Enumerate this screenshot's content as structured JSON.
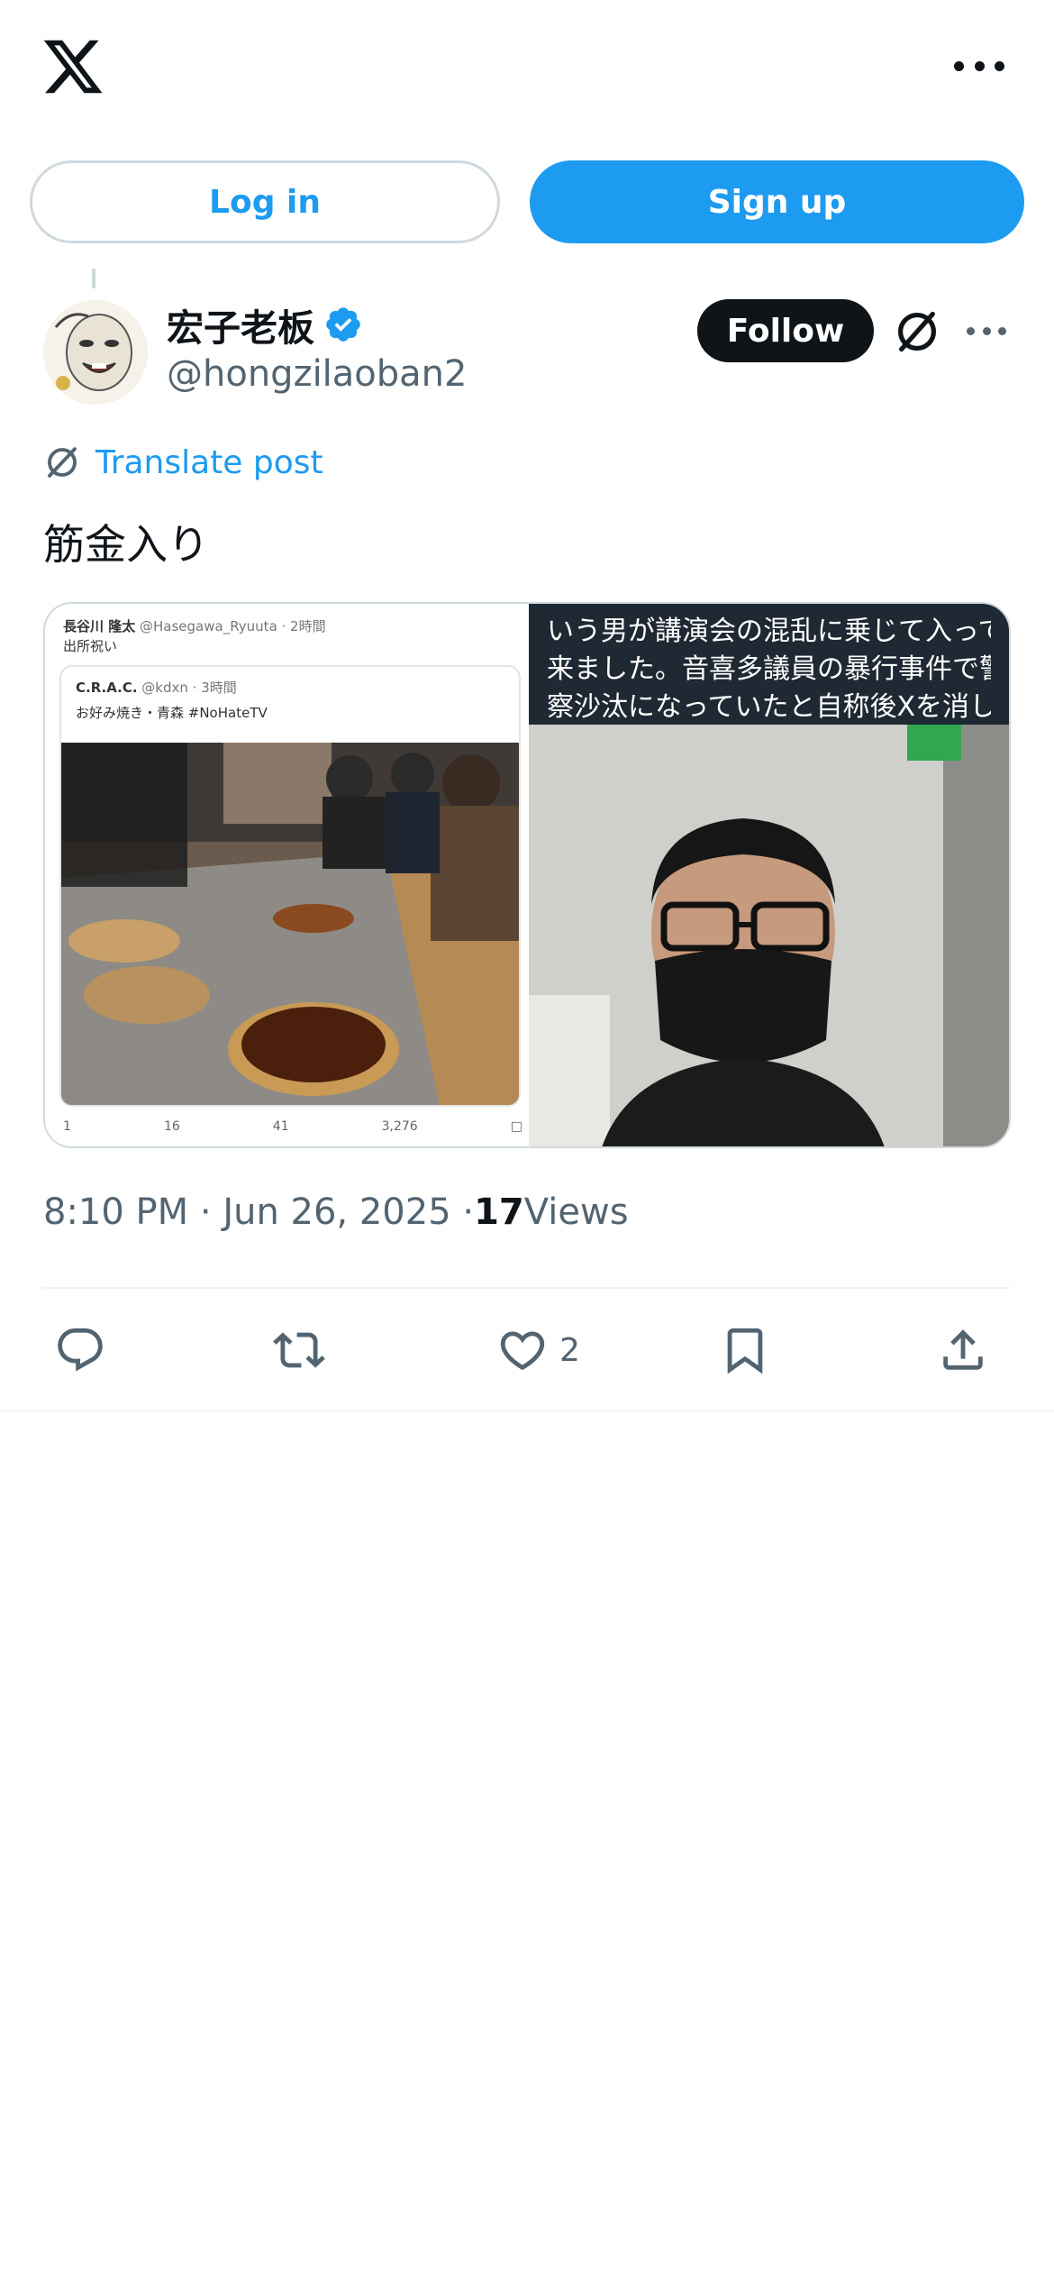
{
  "header": {
    "logo_icon": "x-logo-icon",
    "more_icon": "more-horizontal-icon"
  },
  "auth": {
    "login_label": "Log in",
    "signup_label": "Sign up"
  },
  "post": {
    "author": {
      "display_name": "宏子老板",
      "handle": "@hongzilaoban2",
      "verified": true
    },
    "follow_label": "Follow",
    "translate_label": "Translate post",
    "text": "筋金入り",
    "timestamp": "8:10 PM · Jun 26, 2025 · ",
    "views_count": "17",
    "views_label": " Views",
    "actions": {
      "reply_count": "",
      "repost_count": "",
      "like_count": "2"
    }
  },
  "media": {
    "left_image": {
      "author_name": "長谷川 隆太",
      "author_meta": " @Hasegawa_Ryuuta · 2時間",
      "text": "出所祝い",
      "quoted": {
        "author_name": "C.R.A.C.",
        "author_meta": " @kdxn · 3時間",
        "text": "お好み焼き・青森 #NoHateTV"
      },
      "stats": [
        "1",
        "16",
        "41",
        "3,276"
      ]
    },
    "right_image": {
      "caption_lines": [
        "いう男が講演会の混乱に乗じて入って",
        "来ました。音喜多議員の暴行事件で警",
        "察沙汰になっていたと自称後Xを消し..."
      ]
    }
  },
  "colors": {
    "brand_blue": "#1d9bf0",
    "text_primary": "#0f1419",
    "text_secondary": "#536471",
    "border": "#cfd9de"
  }
}
